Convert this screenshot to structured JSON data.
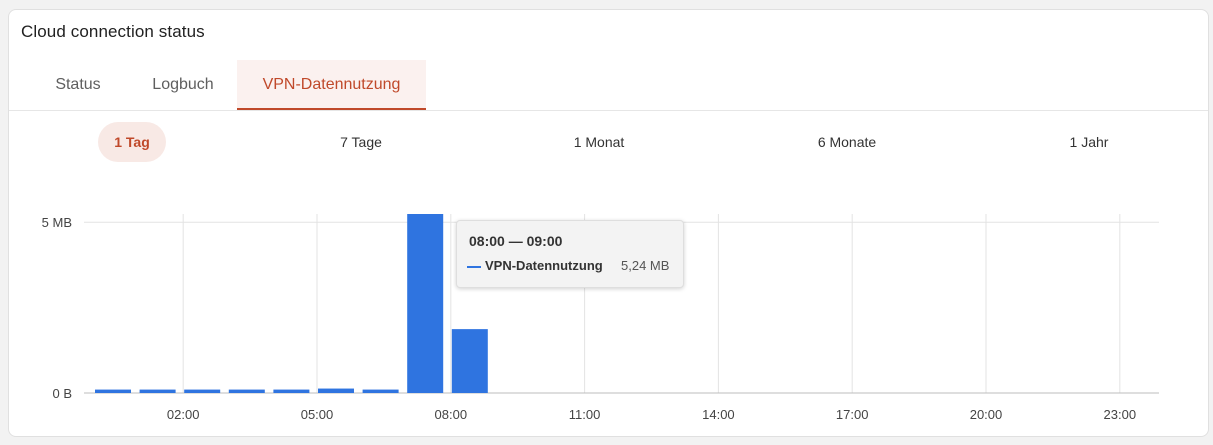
{
  "card": {
    "title": "Cloud connection status"
  },
  "tabs": [
    {
      "label": "Status",
      "active": false
    },
    {
      "label": "Logbuch",
      "active": false
    },
    {
      "label": "VPN-Datennutzung",
      "active": true
    }
  ],
  "ranges": [
    {
      "label": "1 Tag",
      "active": true
    },
    {
      "label": "7 Tage",
      "active": false
    },
    {
      "label": "1 Monat",
      "active": false
    },
    {
      "label": "6 Monate",
      "active": false
    },
    {
      "label": "1 Jahr",
      "active": false
    }
  ],
  "colors": {
    "accent": "#c0492a",
    "bar": "#2f74e0",
    "grid": "#e3e3e3"
  },
  "tooltip": {
    "time": "08:00 — 09:00",
    "series": "VPN-Datennutzung",
    "value": "5,24 MB"
  },
  "chart_data": {
    "type": "bar",
    "y_unit": "MB",
    "ylim": [
      0,
      5.24
    ],
    "y_ticks": [
      {
        "value": 0,
        "label": "0 B"
      },
      {
        "value": 5,
        "label": "5 MB"
      }
    ],
    "x_tick_labels": [
      "02:00",
      "05:00",
      "08:00",
      "11:00",
      "14:00",
      "17:00",
      "20:00",
      "23:00"
    ],
    "x_range_hours": [
      0,
      24
    ],
    "series": [
      {
        "name": "VPN-Datennutzung",
        "bars": [
          {
            "hour": 0,
            "value": 0.1
          },
          {
            "hour": 1,
            "value": 0.1
          },
          {
            "hour": 2,
            "value": 0.1
          },
          {
            "hour": 3,
            "value": 0.1
          },
          {
            "hour": 4,
            "value": 0.1
          },
          {
            "hour": 5,
            "value": 0.13
          },
          {
            "hour": 6,
            "value": 0.1
          },
          {
            "hour": 7,
            "value": 5.24
          },
          {
            "hour": 8,
            "value": 1.87
          }
        ]
      }
    ],
    "grid": true
  }
}
